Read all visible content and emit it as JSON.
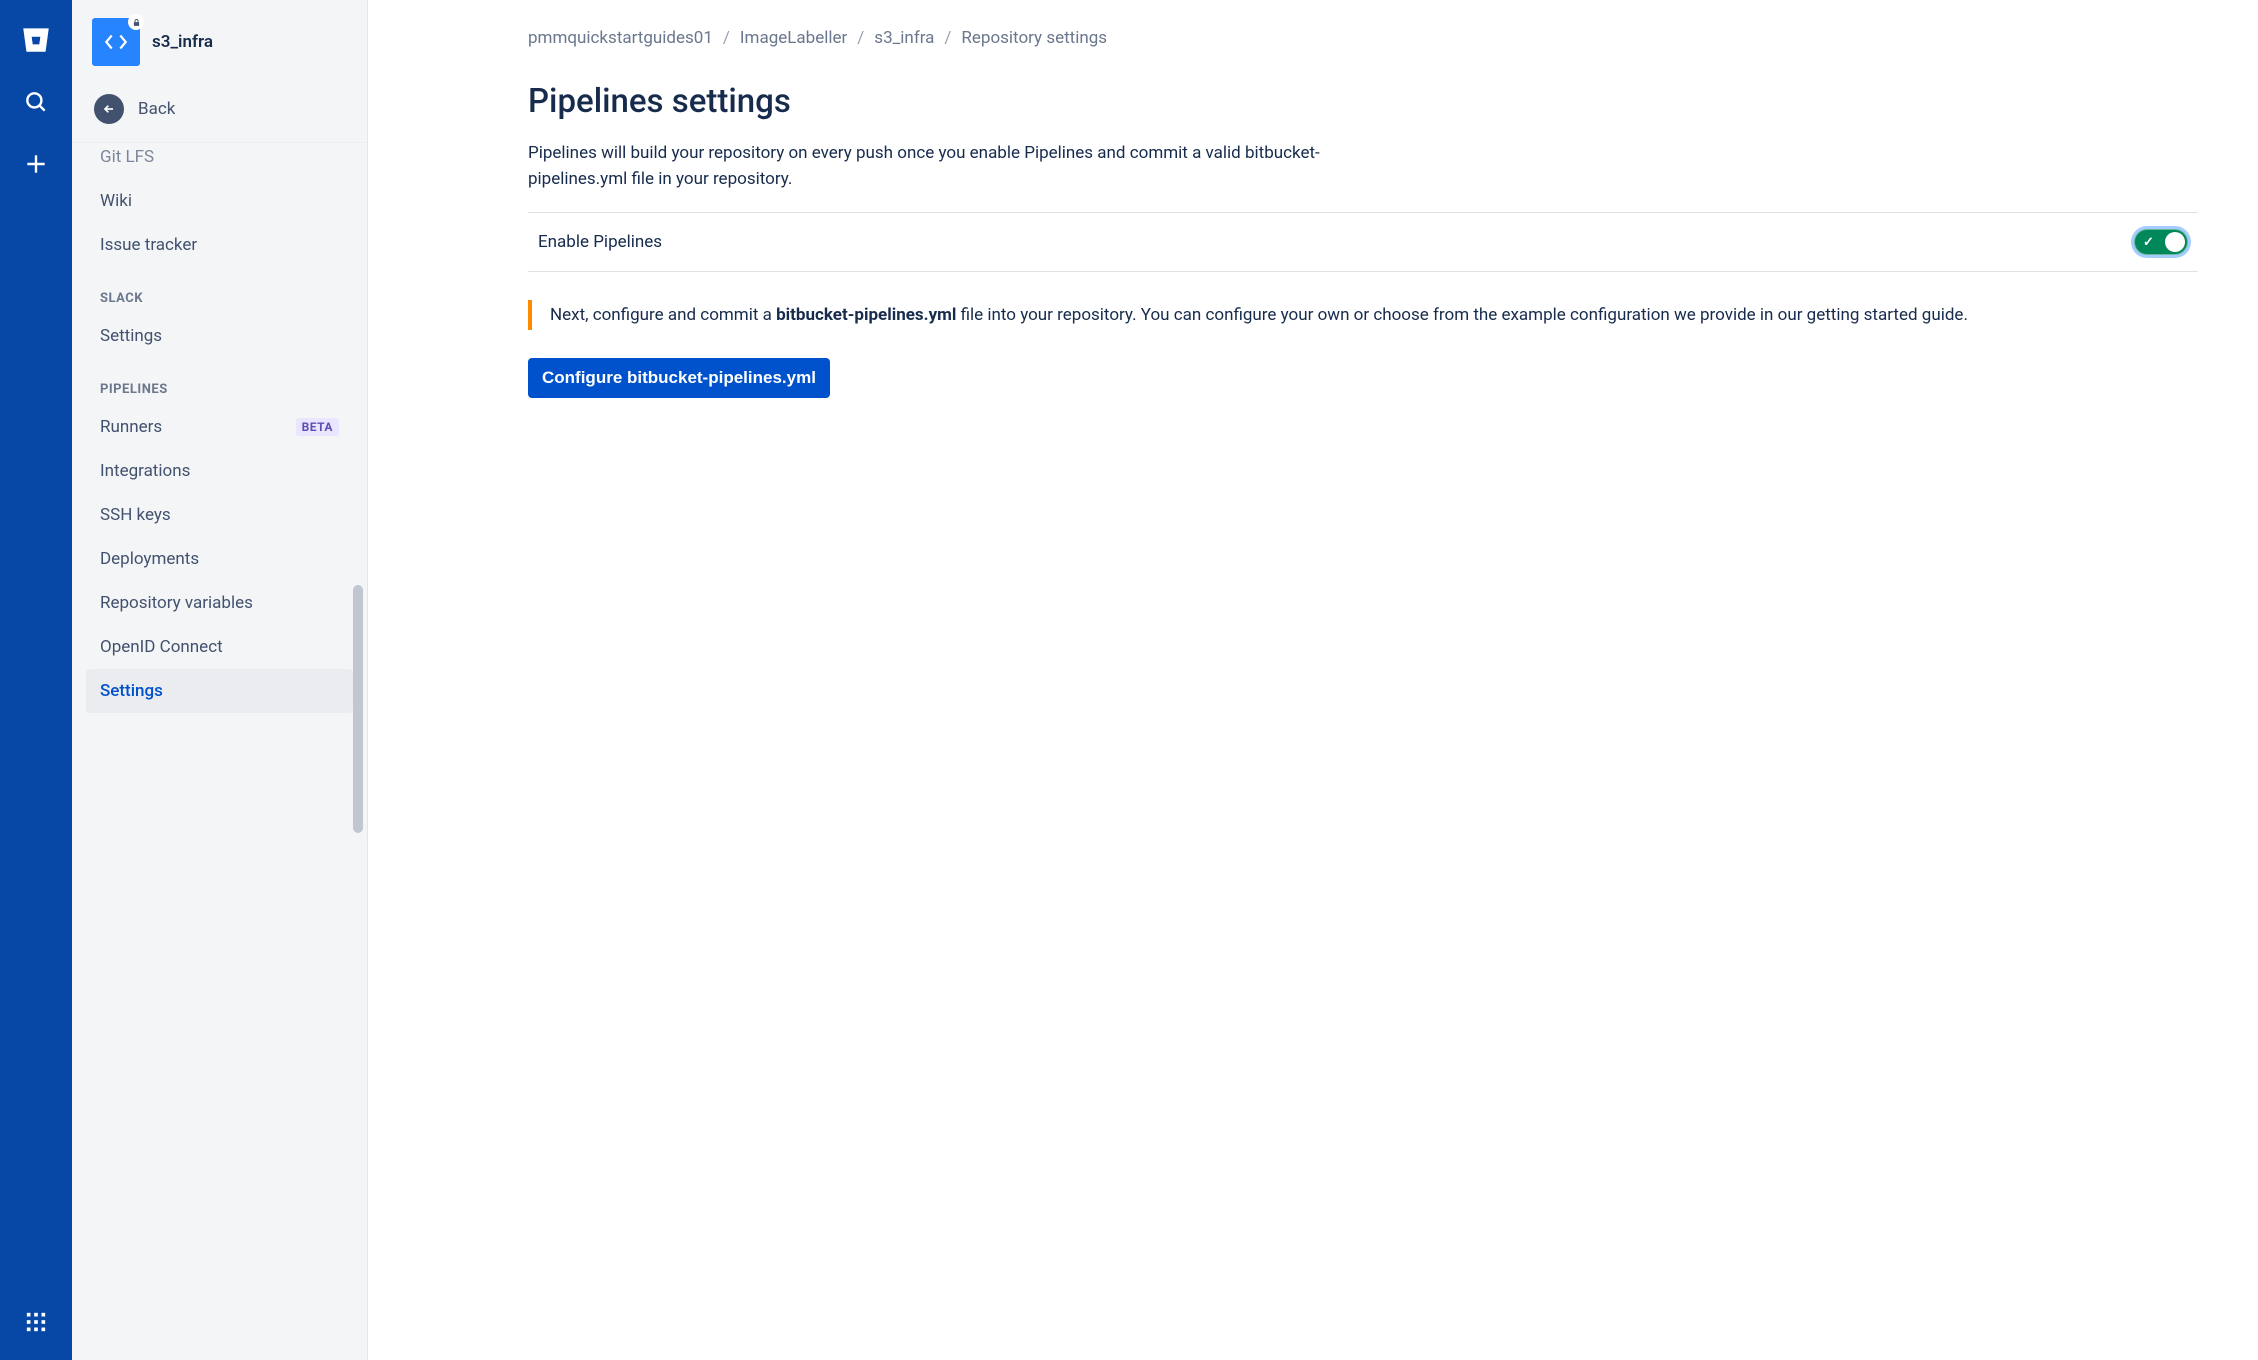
{
  "rail": {
    "icons": {
      "logo": "bitbucket-logo",
      "search": "search-icon",
      "plus": "plus-icon",
      "apps": "apps-icon"
    }
  },
  "sidebar": {
    "repo_name": "s3_infra",
    "back_label": "Back",
    "items_top": [
      {
        "label": "Git LFS",
        "cut": true
      },
      {
        "label": "Wiki"
      },
      {
        "label": "Issue tracker"
      }
    ],
    "section_slack": "SLACK",
    "items_slack": [
      {
        "label": "Settings"
      }
    ],
    "section_pipelines": "PIPELINES",
    "items_pipelines": [
      {
        "label": "Runners",
        "badge": "BETA"
      },
      {
        "label": "Integrations"
      },
      {
        "label": "SSH keys"
      },
      {
        "label": "Deployments"
      },
      {
        "label": "Repository variables"
      },
      {
        "label": "OpenID Connect"
      },
      {
        "label": "Settings",
        "selected": true
      }
    ]
  },
  "breadcrumb": {
    "0": "pmmquickstartguides01",
    "1": "ImageLabeller",
    "2": "s3_infra",
    "3": "Repository settings"
  },
  "main": {
    "title": "Pipelines settings",
    "description": "Pipelines will build your repository on every push once you enable Pipelines and commit a valid bitbucket-pipelines.yml file in your repository.",
    "toggle_label": "Enable Pipelines",
    "toggle_on": true,
    "info_pre": "Next, configure and commit a ",
    "info_bold": "bitbucket-pipelines.yml",
    "info_post": " file into your repository. You can configure your own or choose from the example configuration we provide in our getting started guide.",
    "configure_btn": "Configure bitbucket-pipelines.yml"
  }
}
